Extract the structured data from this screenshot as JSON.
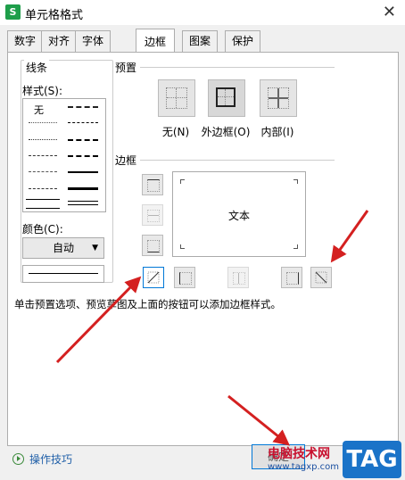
{
  "window": {
    "title": "单元格格式",
    "app_icon": "S"
  },
  "tabs": [
    "数字",
    "对齐",
    "字体",
    "边框",
    "图案",
    "保护"
  ],
  "active_tab": "边框",
  "line": {
    "group_label": "线条",
    "style_label": "样式(S):",
    "none_label": "无",
    "color_label": "颜色(C):",
    "color_value": "自动"
  },
  "presets": {
    "group_label": "预置",
    "none": "无(N)",
    "outline": "外边框(O)",
    "inside": "内部(I)"
  },
  "border": {
    "group_label": "边框",
    "preview_text": "文本"
  },
  "hint": "单击预置选项、预览草图及上面的按钮可以添加边框样式。",
  "footer": {
    "help_link": "操作技巧",
    "ok_label": "确定"
  },
  "watermark": {
    "site_name": "电脑技术网",
    "url": "www.tagxp.com",
    "logo": "TAG"
  },
  "colors": {
    "accent": "#0078d7",
    "arrow": "#d42020",
    "brand_green": "#1e9e4a"
  }
}
